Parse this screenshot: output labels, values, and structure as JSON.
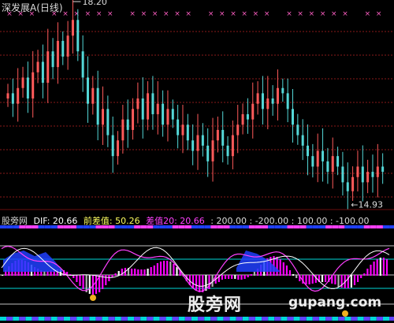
{
  "title": "深发展A(日线)",
  "colors": {
    "up": "#ff5a5a",
    "down": "#54d8d8",
    "marker": "#ff5fc4",
    "grid": "#8a1a1a",
    "dif": "#ffffff",
    "qian": "#ff40ff",
    "hist": "#ff00ff",
    "cyan": "#00d8d8",
    "blue": "#2040ff"
  },
  "chart_data": [
    {
      "type": "candlestick",
      "title": "深发展A(日线)",
      "annotations": [
        {
          "label": "18.20",
          "kind": "high"
        },
        {
          "label": "←14.93",
          "kind": "low"
        }
      ],
      "price_range": [
        14.7,
        18.4
      ],
      "high_value": 18.2,
      "low_value": 14.93,
      "series": [
        {
          "name": "price",
          "values": [
            16.8,
            16.6,
            16.9,
            17.1,
            16.7,
            17.2,
            17.4,
            17.0,
            17.6,
            17.3,
            17.8,
            17.5,
            17.9,
            18.2,
            17.6,
            17.1,
            16.6,
            16.9,
            16.2,
            16.5,
            16.0,
            15.6,
            15.9,
            16.3,
            16.1,
            16.5,
            16.7,
            16.3,
            16.8,
            16.4,
            16.6,
            16.2,
            16.5,
            16.3,
            16.0,
            16.2,
            15.9,
            15.7,
            16.0,
            15.8,
            15.5,
            15.9,
            16.1,
            15.8,
            15.6,
            16.0,
            16.2,
            16.4,
            16.3,
            16.6,
            16.8,
            16.5,
            16.7,
            16.6,
            16.9,
            16.8,
            16.5,
            16.2,
            16.0,
            15.8,
            15.6,
            15.4,
            15.7,
            15.5,
            15.3,
            15.6,
            15.4,
            15.1,
            14.93,
            15.2,
            15.4,
            15.1,
            15.3,
            15.2,
            15.4,
            15.3
          ]
        }
      ]
    },
    {
      "type": "line",
      "title": "股旁网",
      "indicators": [
        {
          "name": "DIF",
          "value": "20.66"
        },
        {
          "name": "前差值",
          "value": "50.26"
        },
        {
          "name": "差值20",
          "value": "20.66"
        }
      ],
      "reference_levels": [
        "200.00",
        "-200.00",
        "100.00",
        "-100.00"
      ]
    }
  ],
  "header": {
    "site": "股旁网",
    "dif": "DIF: 20.66",
    "qian": "前差值: 50.26",
    "cha": "差值20: 20.66",
    "levels": ": 200.00 : -200.00 : 100.00 : -100.00"
  },
  "watermark": {
    "cn": "股旁网",
    "en": "gupang.com"
  }
}
